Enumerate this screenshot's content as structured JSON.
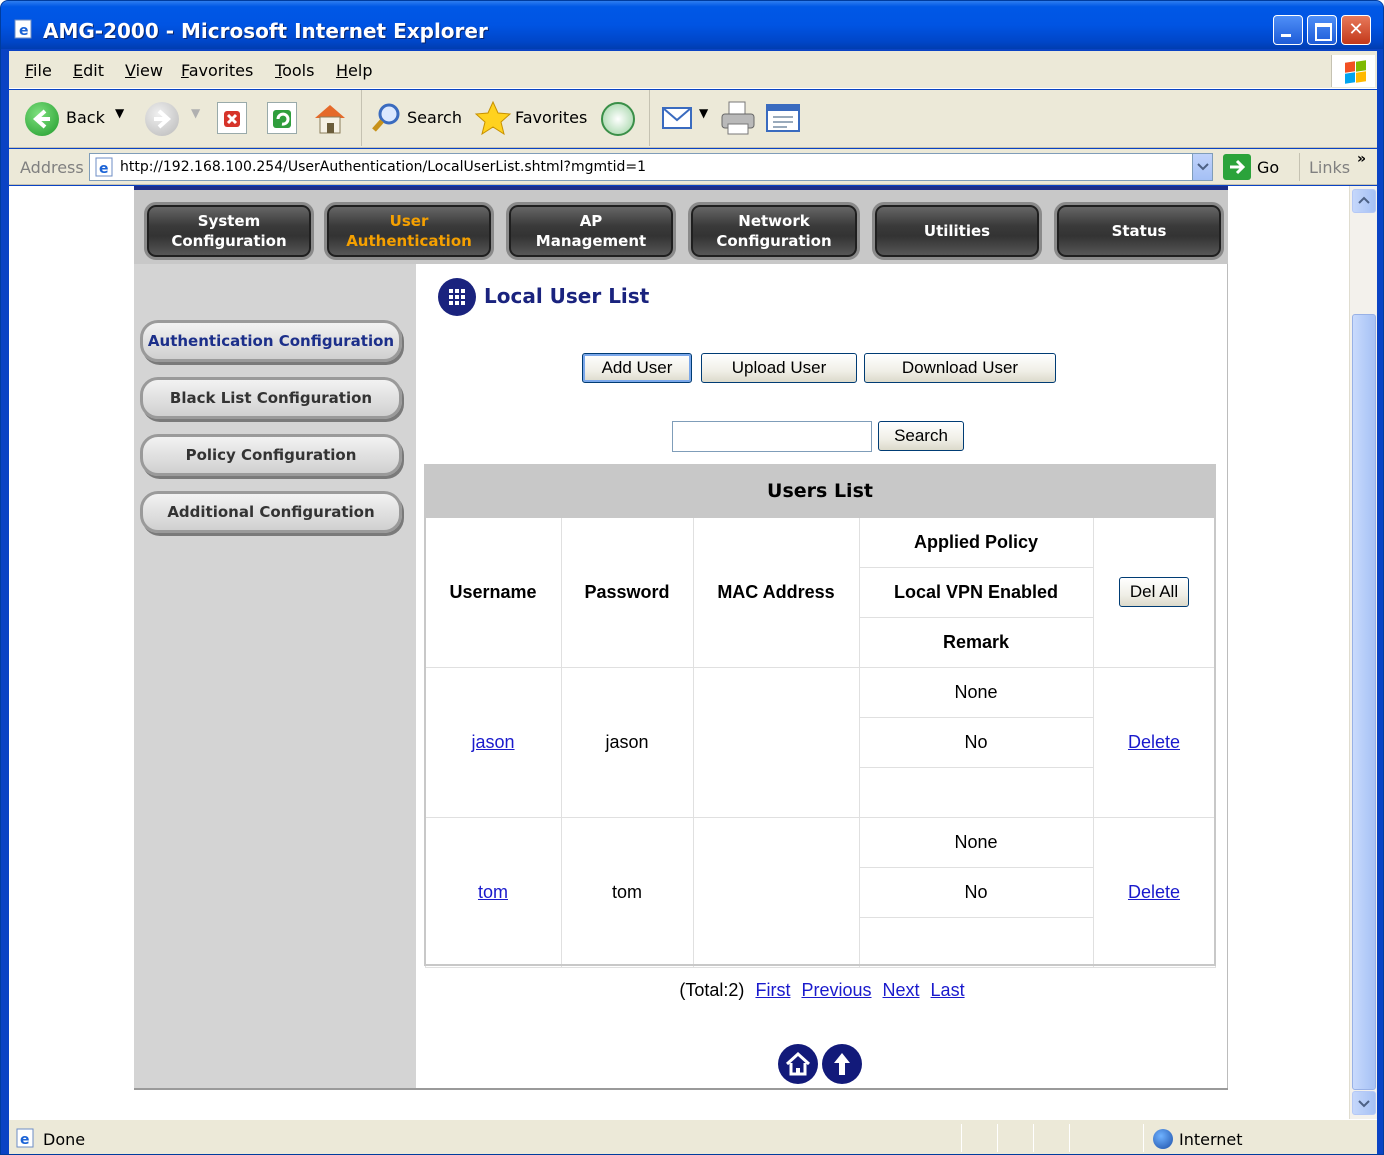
{
  "window": {
    "title": "AMG-2000 - Microsoft Internet Explorer"
  },
  "menu": [
    "File",
    "Edit",
    "View",
    "Favorites",
    "Tools",
    "Help"
  ],
  "toolbar": {
    "back": "Back",
    "search": "Search",
    "favorites": "Favorites"
  },
  "address": {
    "label": "Address",
    "url": "http://192.168.100.254/UserAuthentication/LocalUserList.shtml?mgmtid=1",
    "go": "Go",
    "links": "Links"
  },
  "status": {
    "left": "Done",
    "zone": "Internet"
  },
  "nav": {
    "tabs": [
      {
        "line1": "System",
        "line2": "Configuration",
        "active": false
      },
      {
        "line1": "User",
        "line2": "Authentication",
        "active": true
      },
      {
        "line1": "AP",
        "line2": "Management",
        "active": false
      },
      {
        "line1": "Network",
        "line2": "Configuration",
        "active": false
      },
      {
        "line1": "Utilities",
        "line2": "",
        "active": false
      },
      {
        "line1": "Status",
        "line2": "",
        "active": false
      }
    ]
  },
  "sidebar": {
    "items": [
      {
        "label": "Authentication Configuration",
        "active": true
      },
      {
        "label": "Black List Configuration",
        "active": false
      },
      {
        "label": "Policy Configuration",
        "active": false
      },
      {
        "label": "Additional Configuration",
        "active": false
      }
    ]
  },
  "page": {
    "title": "Local User List",
    "buttons": {
      "add": "Add User",
      "upload": "Upload User",
      "download": "Download User"
    },
    "search": {
      "value": "",
      "button": "Search"
    }
  },
  "table": {
    "caption": "Users List",
    "headers": {
      "username": "Username",
      "password": "Password",
      "mac": "MAC Address",
      "policy": "Applied Policy",
      "vpn": "Local VPN Enabled",
      "remark": "Remark",
      "delall": "Del All"
    },
    "rows": [
      {
        "username": "jason",
        "password": "jason",
        "mac": "",
        "policy": "None",
        "vpn": "No",
        "remark": "",
        "action": "Delete"
      },
      {
        "username": "tom",
        "password": "tom",
        "mac": "",
        "policy": "None",
        "vpn": "No",
        "remark": "",
        "action": "Delete"
      }
    ]
  },
  "pager": {
    "total": "(Total:2)",
    "first": "First",
    "previous": "Previous",
    "next": "Next",
    "last": "Last"
  },
  "colors": {
    "title_blue": "#1a237e",
    "link_blue": "#1a1acc",
    "active_tab": "#f5a000",
    "xp_blue": "#0054e3"
  }
}
